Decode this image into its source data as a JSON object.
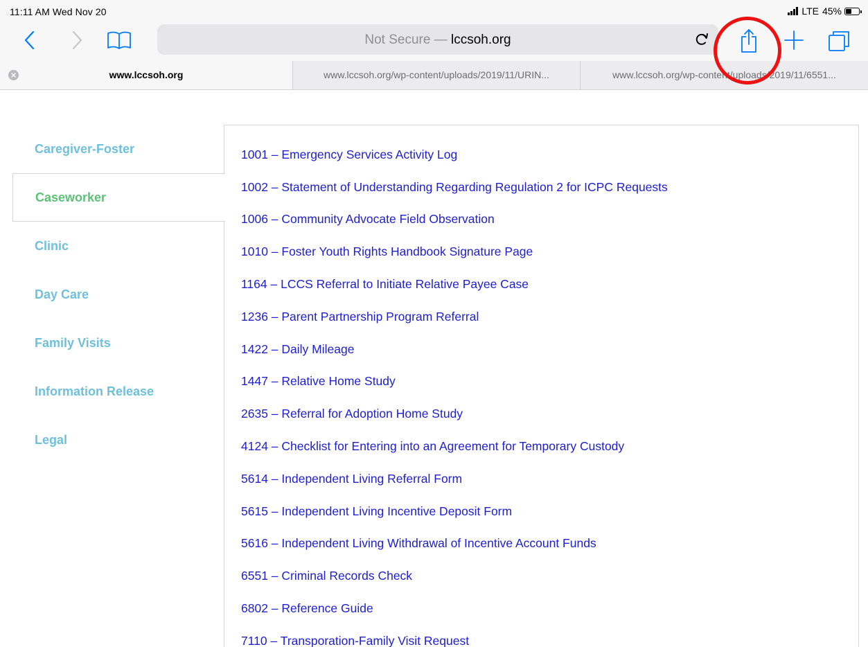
{
  "status_bar": {
    "time": "11:11 AM  Wed Nov 20",
    "network": "LTE",
    "battery": "45%",
    "battery_level": 0.45
  },
  "toolbar": {
    "address_prefix": "Not Secure — ",
    "address_domain": "lccsoh.org",
    "icons": {
      "back": "chevron-left-icon",
      "forward": "chevron-right-icon",
      "bookmarks": "book-icon",
      "reload": "reload-icon",
      "share": "share-icon",
      "new_tab": "plus-icon",
      "tabs": "tabs-icon"
    },
    "accent_color": "#007aff",
    "highlight_color": "#ee1111"
  },
  "tabs": [
    {
      "label": "www.lccsoh.org",
      "active": true
    },
    {
      "label": "www.lccsoh.org/wp-content/uploads/2019/11/URIN...",
      "active": false
    },
    {
      "label": "www.lccsoh.org/wp-content/uploads/2019/11/6551...",
      "active": false
    }
  ],
  "sidebar": {
    "items": [
      {
        "label": "Caregiver-Foster",
        "active": false
      },
      {
        "label": "Caseworker",
        "active": true
      },
      {
        "label": "Clinic",
        "active": false
      },
      {
        "label": "Day Care",
        "active": false
      },
      {
        "label": "Family Visits",
        "active": false
      },
      {
        "label": "Information Release",
        "active": false
      },
      {
        "label": "Legal",
        "active": false
      }
    ],
    "link_color": "#6fc0dc",
    "active_color": "#5cc27a"
  },
  "documents": [
    "1001 – Emergency Services Activity Log",
    "1002 – Statement of Understanding Regarding Regulation 2 for ICPC Requests",
    "1006 – Community Advocate Field Observation",
    "1010 – Foster Youth Rights Handbook Signature Page",
    "1164 – LCCS Referral to Initiate Relative Payee Case",
    "1236 – Parent Partnership Program Referral",
    "1422 – Daily Mileage",
    "1447 – Relative Home Study",
    "2635 – Referral for Adoption Home Study",
    "4124 – Checklist for Entering into an Agreement for Temporary Custody",
    "5614 – Independent Living Referral Form",
    "5615 – Independent Living Incentive Deposit Form",
    "5616 – Independent Living Withdrawal of Incentive Account Funds",
    "6551 – Criminal Records Check",
    "6802 – Reference Guide",
    "7110 – Transporation-Family Visit Request"
  ]
}
